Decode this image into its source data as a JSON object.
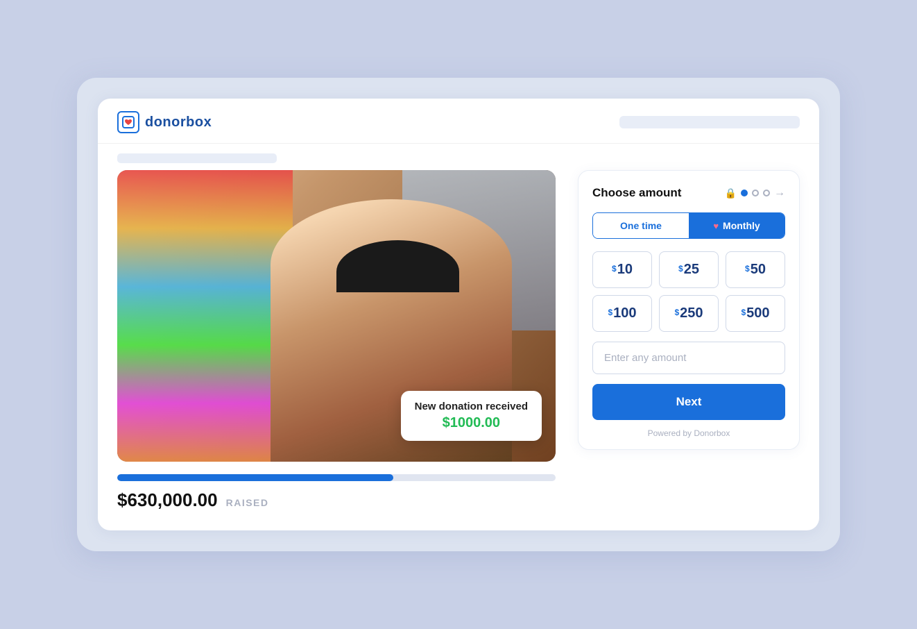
{
  "branding": {
    "logo_text": "donorbox",
    "logo_icon_symbol": "♥"
  },
  "header": {
    "title": "donorbox"
  },
  "panel": {
    "title": "Choose amount",
    "steps": {
      "lock_symbol": "🔒",
      "step1_active": true,
      "step2_active": false,
      "step3_active": false,
      "arrow": "→"
    },
    "frequency": {
      "one_time_label": "One time",
      "monthly_label": "Monthly",
      "active": "monthly",
      "heart": "♥"
    },
    "amounts": [
      {
        "symbol": "$",
        "value": "10"
      },
      {
        "symbol": "$",
        "value": "25"
      },
      {
        "symbol": "$",
        "value": "50"
      },
      {
        "symbol": "$",
        "value": "100"
      },
      {
        "symbol": "$",
        "value": "250"
      },
      {
        "symbol": "$",
        "value": "500"
      }
    ],
    "custom_amount_placeholder": "Enter any amount",
    "next_button_label": "Next",
    "powered_by": "Powered by Donorbox"
  },
  "fundraising": {
    "notification": {
      "title": "New donation received",
      "amount": "$1000.00"
    },
    "progress": {
      "raised_amount": "$630,000.00",
      "raised_label": "RAISED",
      "percent": 63
    }
  }
}
